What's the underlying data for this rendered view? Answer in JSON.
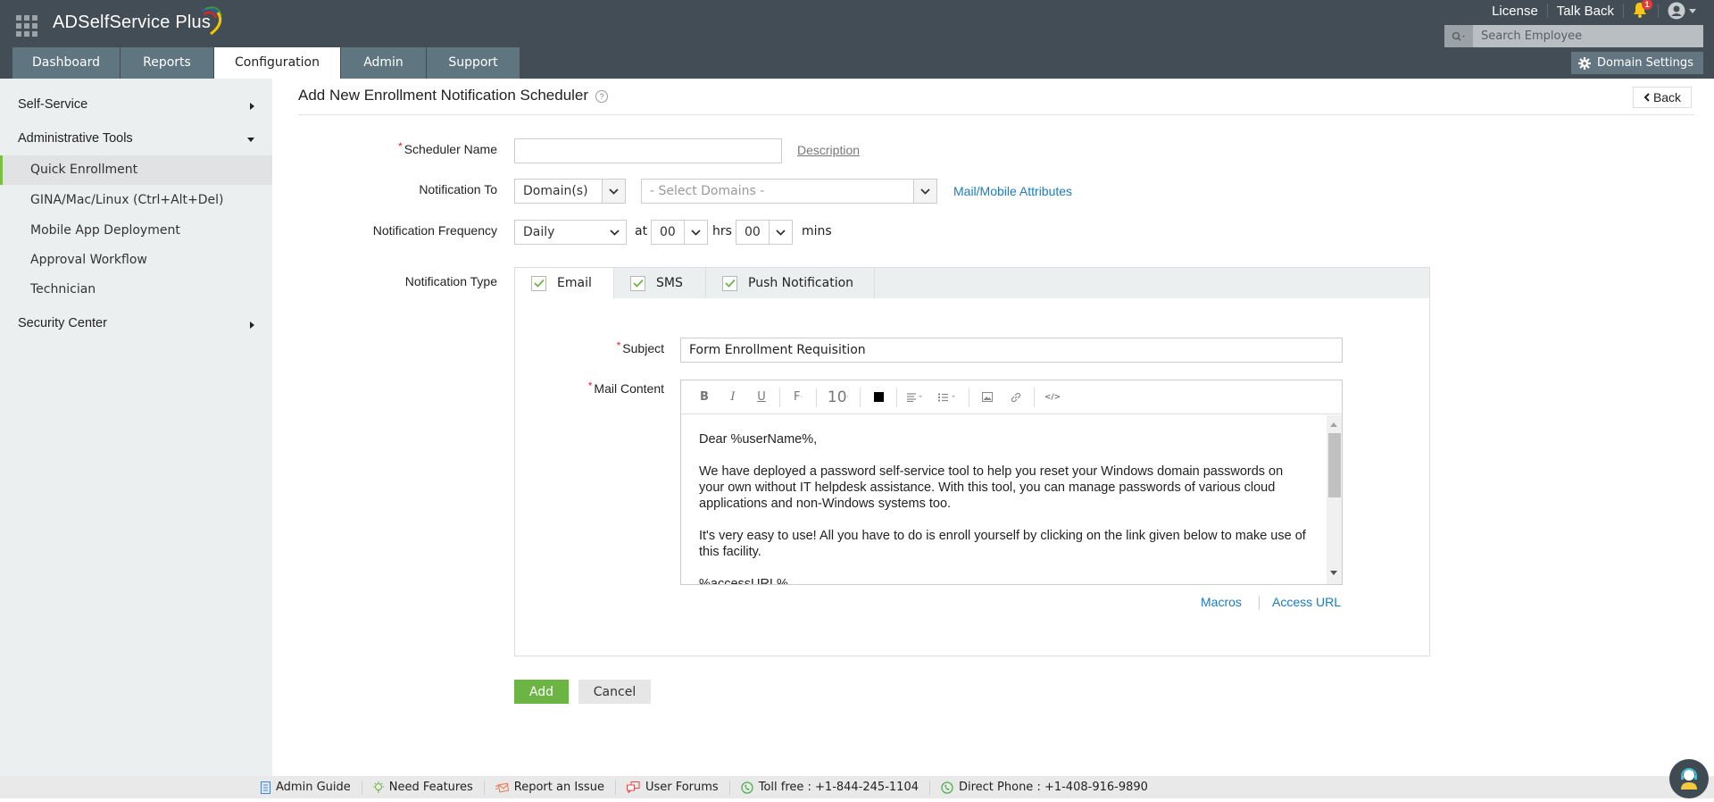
{
  "app": {
    "brand_name": "ADSelfService",
    "brand_suffix": "Plus"
  },
  "header": {
    "links": [
      "License",
      "Talk Back"
    ],
    "notification_count": "1",
    "search_placeholder": "Search Employee",
    "domain_settings_label": "Domain Settings",
    "tabs": [
      {
        "label": "Dashboard",
        "active": false
      },
      {
        "label": "Reports",
        "active": false
      },
      {
        "label": "Configuration",
        "active": true
      },
      {
        "label": "Admin",
        "active": false
      },
      {
        "label": "Support",
        "active": false
      }
    ]
  },
  "sidebar": {
    "sections": [
      {
        "label": "Self-Service",
        "expanded": false
      },
      {
        "label": "Administrative Tools",
        "expanded": true
      },
      {
        "label": "Security Center",
        "expanded": false
      }
    ],
    "items": [
      {
        "label": "Quick Enrollment",
        "active": true
      },
      {
        "label": "GINA/Mac/Linux (Ctrl+Alt+Del)",
        "active": false
      },
      {
        "label": "Mobile App Deployment",
        "active": false
      },
      {
        "label": "Approval Workflow",
        "active": false
      },
      {
        "label": "Technician",
        "active": false
      }
    ]
  },
  "page": {
    "title": "Add New Enrollment Notification Scheduler",
    "help_icon": "?",
    "back_label": "Back"
  },
  "form": {
    "scheduler_name": {
      "label": "Scheduler Name",
      "value": "",
      "required": true
    },
    "description_link": "Description",
    "notification_to": {
      "label": "Notification To",
      "type_value": "Domain(s)",
      "domains_placeholder": "- Select Domains -",
      "attributes_link": "Mail/Mobile Attributes"
    },
    "notification_frequency": {
      "label": "Notification Frequency",
      "value": "Daily",
      "at_label": "at",
      "hours": "00",
      "hrs_label": "hrs",
      "minutes": "00",
      "mins_label": "mins"
    },
    "notification_type": {
      "label": "Notification Type",
      "tabs": [
        {
          "label": "Email",
          "checked": true,
          "active": true
        },
        {
          "label": "SMS",
          "checked": true,
          "active": false
        },
        {
          "label": "Push Notification",
          "checked": true,
          "active": false
        }
      ]
    },
    "subject": {
      "label": "Subject",
      "value": "Form Enrollment Requisition",
      "required": true
    },
    "mail_content": {
      "label": "Mail Content",
      "required": true,
      "font_size": "10",
      "paragraphs": [
        "Dear %userName%,",
        "We have deployed a password self-service tool to help you reset your Windows domain passwords on your own without IT helpdesk assistance. With this tool, you can manage passwords of various cloud applications and non-Windows systems too.",
        "It's very easy to use! All you have to do is enroll yourself by clicking on the link given below to make use of this facility.",
        "%accessURL%"
      ]
    },
    "macros_link": "Macros",
    "access_url_link": "Access URL",
    "add_label": "Add",
    "cancel_label": "Cancel"
  },
  "footer": {
    "links": [
      "Admin Guide",
      "Need Features",
      "Report an Issue",
      "User Forums"
    ],
    "toll_free": "Toll free : +1-844-245-1104",
    "direct_phone": "Direct Phone : +1-408-916-9890"
  },
  "colors": {
    "header_bg": "#424d55",
    "tab_bg": "#5f7580",
    "accent_green": "#6cb443",
    "link_blue": "#1b7bc0",
    "required_red": "#e02525"
  }
}
